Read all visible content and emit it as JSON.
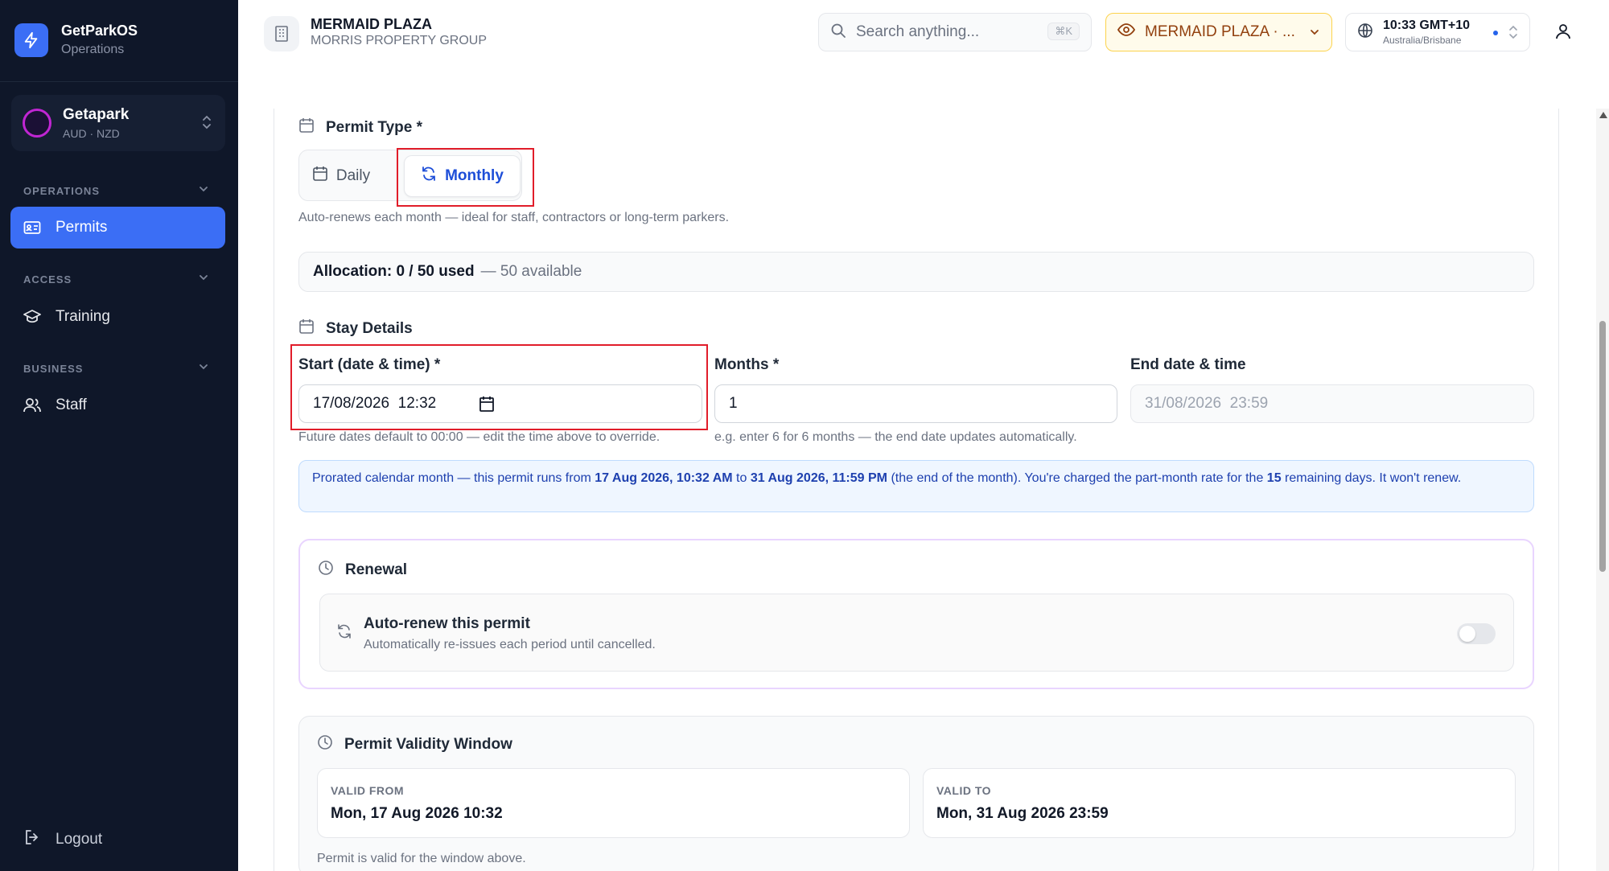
{
  "brand": {
    "title": "GetParkOS",
    "subtitle": "Operations"
  },
  "org": {
    "name": "Getapark",
    "currencies": "AUD · NZD"
  },
  "sidebar": {
    "sections": [
      {
        "label": "OPERATIONS",
        "items": [
          {
            "label": "Permits",
            "icon": "id-card-icon",
            "active": true
          }
        ]
      },
      {
        "label": "ACCESS",
        "items": [
          {
            "label": "Training",
            "icon": "graduation-cap-icon"
          }
        ]
      },
      {
        "label": "BUSINESS",
        "items": [
          {
            "label": "Staff",
            "icon": "users-icon"
          }
        ]
      }
    ],
    "logout": "Logout"
  },
  "header": {
    "property_name": "MERMAID PLAZA",
    "property_group": "MORRIS PROPERTY GROUP",
    "search_placeholder": "Search anything...",
    "search_shortcut": "⌘K",
    "viewing_label": "MERMAID PLAZA · ...",
    "time": "10:33 GMT+10",
    "timezone": "Australia/Brisbane"
  },
  "permit_type": {
    "heading": "Permit Type *",
    "options": [
      "Daily",
      "Monthly"
    ],
    "selected": "Monthly",
    "help": "Auto-renews each month — ideal for staff, contractors or long-term parkers."
  },
  "allocation": {
    "used": "Allocation: 0 / 50 used",
    "available": "— 50 available"
  },
  "stay": {
    "heading": "Stay Details",
    "start_label": "Start (date & time) *",
    "start_value": "17/08/2026  12:32",
    "start_help": "Future dates default to 00:00 — edit the time above to override.",
    "months_label": "Months *",
    "months_value": "1",
    "months_help": "e.g. enter 6 for 6 months — the end date updates automatically.",
    "end_label": "End date & time",
    "end_value": "31/08/2026  23:59"
  },
  "info": {
    "p1": "Prorated calendar month — this permit runs from ",
    "from": "17 Aug 2026, 10:32 AM",
    "p2": " to ",
    "to": "31 Aug 2026, 11:59 PM",
    "p3": " (the end of the month). You're charged the part-month rate for the ",
    "days": "15",
    "p4": " remaining days. It won't renew."
  },
  "renewal": {
    "heading": "Renewal",
    "title": "Auto-renew this permit",
    "subtitle": "Automatically re-issues each period until cancelled.",
    "enabled": false
  },
  "validity": {
    "heading": "Permit Validity Window",
    "from_caption": "VALID FROM",
    "from_value": "Mon, 17 Aug 2026 10:32",
    "to_caption": "VALID TO",
    "to_value": "Mon, 31 Aug 2026 23:59",
    "note": "Permit is valid for the window above."
  },
  "colors": {
    "accent": "#3b6ef5",
    "sidebar_bg": "#0f1729",
    "highlight": "#e11d2a",
    "monthly_text": "#1d4ed8"
  }
}
